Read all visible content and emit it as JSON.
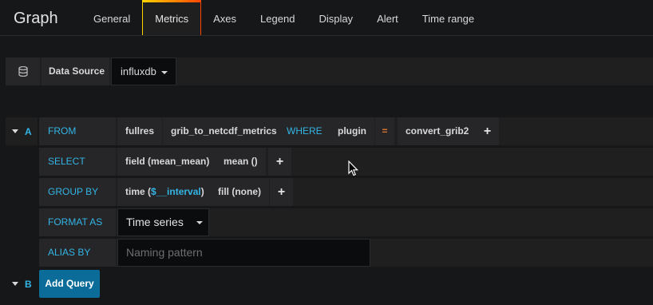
{
  "panel": {
    "title": "Graph"
  },
  "tabs": [
    {
      "label": "General"
    },
    {
      "label": "Metrics"
    },
    {
      "label": "Axes"
    },
    {
      "label": "Legend"
    },
    {
      "label": "Display"
    },
    {
      "label": "Alert"
    },
    {
      "label": "Time range"
    }
  ],
  "active_tab": "Metrics",
  "datasource": {
    "label": "Data Source",
    "value": "influxdb",
    "icon": "database-icon"
  },
  "queries": [
    {
      "ref": "A",
      "from": {
        "keyword": "FROM",
        "policy": "fullres",
        "measurement": "grib_to_netcdf_metrics",
        "where_keyword": "WHERE",
        "tag_key": "plugin",
        "operator": "=",
        "tag_value": "convert_grib2"
      },
      "select": {
        "keyword": "SELECT",
        "field": "field (mean_mean)",
        "func": "mean ()"
      },
      "group_by": {
        "keyword": "GROUP BY",
        "time_prefix": "time (",
        "time_var": "$__interval",
        "time_suffix": ")",
        "fill": "fill (none)"
      },
      "format_as": {
        "keyword": "FORMAT AS",
        "value": "Time series"
      },
      "alias_by": {
        "keyword": "ALIAS BY",
        "placeholder": "Naming pattern"
      }
    },
    {
      "ref": "B"
    }
  ],
  "add_query_label": "Add Query",
  "plus_label": "+",
  "colors": {
    "accent": "#33b5e5",
    "operator": "#e0752d",
    "button": "#0b6c9a",
    "background": "#161719"
  }
}
